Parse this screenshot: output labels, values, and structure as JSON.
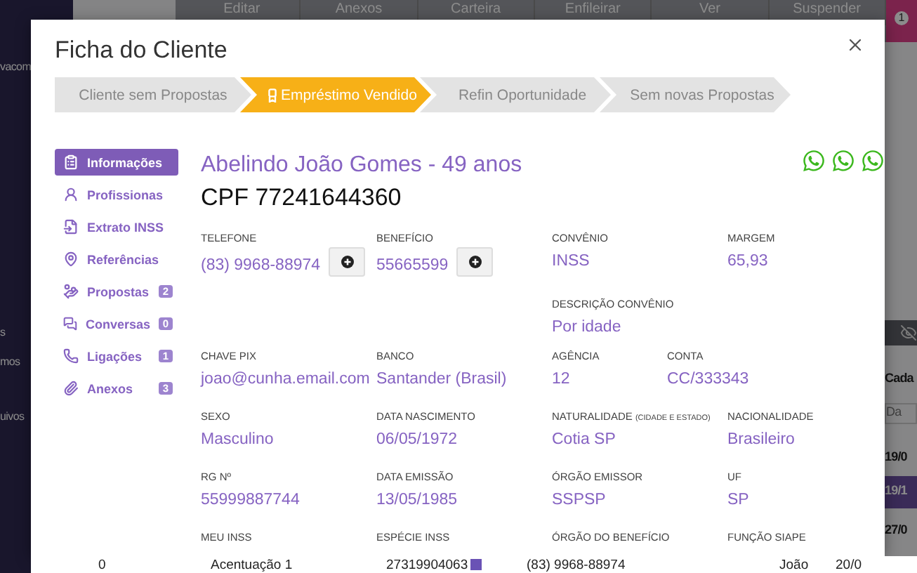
{
  "background": {
    "sidebar_texts": [
      "vacom",
      "s",
      "mos",
      "uivos"
    ],
    "toolbar": [
      "Editar",
      "Anexos",
      "Carteira",
      "Enfileirar",
      "Ver",
      "Suspender"
    ],
    "notification_count": "1",
    "side_texts": [
      {
        "text": "Cada",
        "kind": "plain"
      },
      {
        "text": "Da",
        "kind": "field"
      },
      {
        "text": "19/0",
        "kind": "plain"
      },
      {
        "text": "19/1",
        "kind": "highlight"
      },
      {
        "text": "27/0",
        "kind": "plain"
      }
    ],
    "table_row": [
      "0",
      "Acentuação 1",
      "27319904063",
      "(83) 9968-88974",
      "João",
      "20/0"
    ]
  },
  "modal": {
    "title": "Ficha do Cliente",
    "steps": [
      {
        "label": "Cliente sem Propostas",
        "selected": false
      },
      {
        "label": "Empréstimo Vendido",
        "selected": true
      },
      {
        "label": "Refin Oportunidade",
        "selected": false
      },
      {
        "label": "Sem novas Propostas",
        "selected": false
      }
    ],
    "menu": [
      {
        "label": "Informações",
        "selected": true
      },
      {
        "label": "Profissionas",
        "selected": false
      },
      {
        "label": "Extrato INSS",
        "selected": false
      },
      {
        "label": "Referências",
        "selected": false
      },
      {
        "label": "Propostas",
        "badge": "2",
        "selected": false
      },
      {
        "label": "Conversas",
        "badge": "0",
        "selected": false
      },
      {
        "label": "Ligações",
        "badge": "1",
        "selected": false
      },
      {
        "label": "Anexos",
        "badge": "3",
        "selected": false
      }
    ],
    "client_name": "Abelindo João Gomes - 49 anos",
    "cpf": "CPF 77241644360",
    "rows": [
      [
        {
          "label": "TELEFONE",
          "value": "(83) 9968-88974",
          "kind": "action"
        },
        {
          "label": "BENEFÍCIO",
          "value": "55665599",
          "kind": "action"
        },
        {
          "label": "CONVÊNIO",
          "value": "INSS",
          "kind": "plain",
          "detail": {
            "label": "DESCRIÇÃO CONVÊNIO",
            "value": "Por idade"
          }
        },
        {
          "label": "MARGEM",
          "value": "65,93",
          "kind": "plain"
        }
      ],
      [
        {
          "label": "CHAVE PIX",
          "value": "joao@cunha.email.com",
          "kind": "plain"
        },
        {
          "label": "BANCO",
          "value": "Santander (Brasil)",
          "kind": "plain"
        },
        {
          "kind": "pair",
          "parts": [
            {
              "label": "AGÊNCIA",
              "value": "12"
            },
            {
              "label": "CONTA",
              "value": "CC/333343"
            }
          ]
        }
      ],
      [
        {
          "label": "SEXO",
          "value": "Masculino",
          "kind": "plain"
        },
        {
          "label": "DATA NASCIMENTO",
          "value": "06/05/1972",
          "kind": "plain"
        },
        {
          "label": "NATURALIDADE",
          "note": "(CIDADE E ESTADO)",
          "value": "Cotia SP",
          "kind": "plain"
        },
        {
          "label": "NACIONALIDADE",
          "value": "Brasileiro",
          "kind": "plain"
        }
      ],
      [
        {
          "label": "RG Nº",
          "value": "55999887744",
          "kind": "plain"
        },
        {
          "label": "DATA EMISSÃO",
          "value": "13/05/1985",
          "kind": "plain"
        },
        {
          "label": "ÓRGÃO EMISSOR",
          "value": "SSPSP",
          "kind": "plain"
        },
        {
          "label": "UF",
          "value": "SP",
          "kind": "plain"
        }
      ],
      [
        {
          "label": "MEU INSS",
          "kind": "label"
        },
        {
          "label": "ESPÉCIE INSS",
          "kind": "label"
        },
        {
          "label": "ÓRGÃO DO BENEFÍCIO",
          "kind": "label"
        },
        {
          "label": "FUNÇÃO SIAPE",
          "kind": "label"
        }
      ]
    ]
  }
}
